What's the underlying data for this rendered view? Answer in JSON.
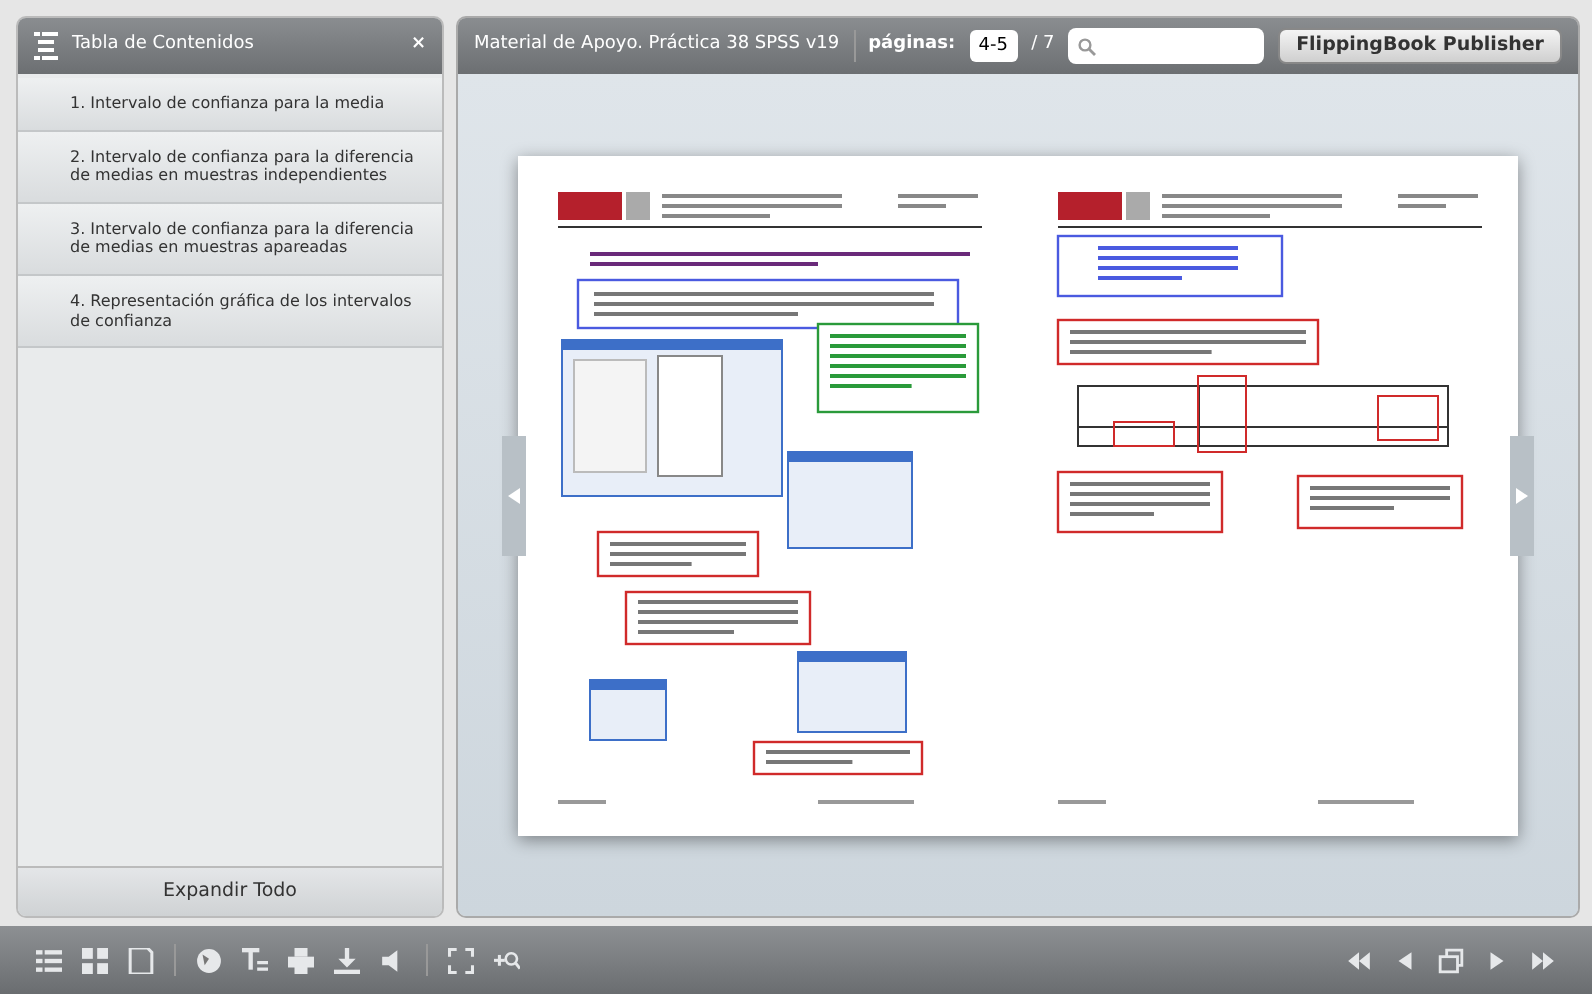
{
  "sidebar": {
    "title": "Tabla de Contenidos",
    "close": "×",
    "items": [
      {
        "label": "1. Intervalo de confianza para la media",
        "selected": false
      },
      {
        "label": "2. Intervalo de confianza para la diferencia de medias en muestras independientes",
        "selected": false
      },
      {
        "label": "3.  Intervalo de confianza para la diferencia de medias en muestras apareadas",
        "selected": false
      },
      {
        "label": "4. Representación gráfica de los intervalos de confianza",
        "selected": false
      }
    ],
    "expand_button": "Expandir Todo"
  },
  "header": {
    "title": "Material de Apoyo. Práctica 38 SPSS v19",
    "pages_label": "páginas:",
    "page_value": "4-5",
    "total": "/ 7",
    "publisher_button": "FlippingBook Publisher"
  }
}
